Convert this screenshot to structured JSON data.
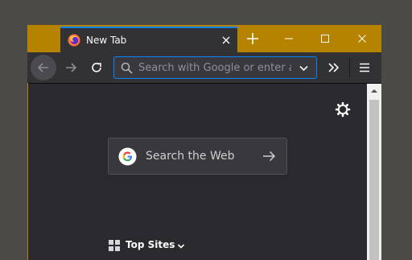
{
  "tab": {
    "title": "New Tab",
    "favicon": "firefox-icon",
    "close_icon": "close-icon"
  },
  "titlebar": {
    "new_tab_icon": "plus-icon",
    "minimize_icon": "minimize-icon",
    "maximize_icon": "maximize-icon",
    "close_icon": "close-icon"
  },
  "navbar": {
    "back_icon": "arrow-left-icon",
    "forward_icon": "arrow-right-icon",
    "reload_icon": "reload-icon",
    "url_placeholder": "Search with Google or enter address",
    "url_value": "",
    "dropdown_icon": "chevron-down-icon",
    "overflow_icon": "double-chevron-right-icon",
    "menu_icon": "hamburger-menu-icon"
  },
  "newtab": {
    "settings_icon": "gear-icon",
    "search_label": "Search the Web",
    "search_logo": "google-logo-icon",
    "search_go_icon": "arrow-right-icon",
    "top_sites_label": "Top Sites",
    "top_sites_icon": "grid-icon",
    "top_sites_toggle_icon": "chevron-down-icon"
  },
  "colors": {
    "titlebar": "#b58300",
    "toolbar": "#323234",
    "content": "#2a2a2e",
    "accent": "#0a84ff",
    "desktop": "#4b4a47"
  }
}
